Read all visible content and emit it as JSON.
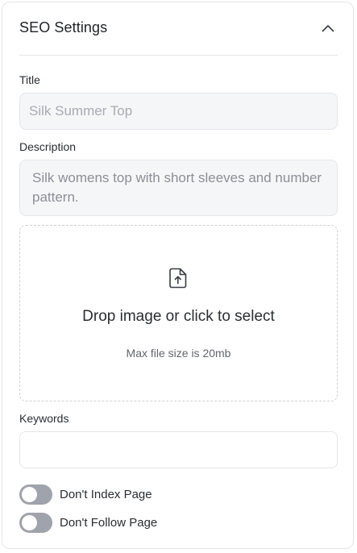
{
  "panel": {
    "title": "SEO Settings",
    "collapse_icon": "chevron-up-icon"
  },
  "title_field": {
    "label": "Title",
    "placeholder": "Silk Summer Top",
    "value": ""
  },
  "description_field": {
    "label": "Description",
    "value": "Silk womens top with short sleeves and number pattern."
  },
  "image_upload": {
    "icon": "file-upload-icon",
    "prompt": "Drop image or click to select",
    "hint": "Max file size is 20mb"
  },
  "keywords_field": {
    "label": "Keywords",
    "value": ""
  },
  "toggles": [
    {
      "label": "Don't Index Page",
      "on": false
    },
    {
      "label": "Don't Follow Page",
      "on": false
    }
  ],
  "colors": {
    "toggle_off": "#9fa3ab",
    "field_bg": "#f5f6f8",
    "border": "#e4e6ea"
  }
}
